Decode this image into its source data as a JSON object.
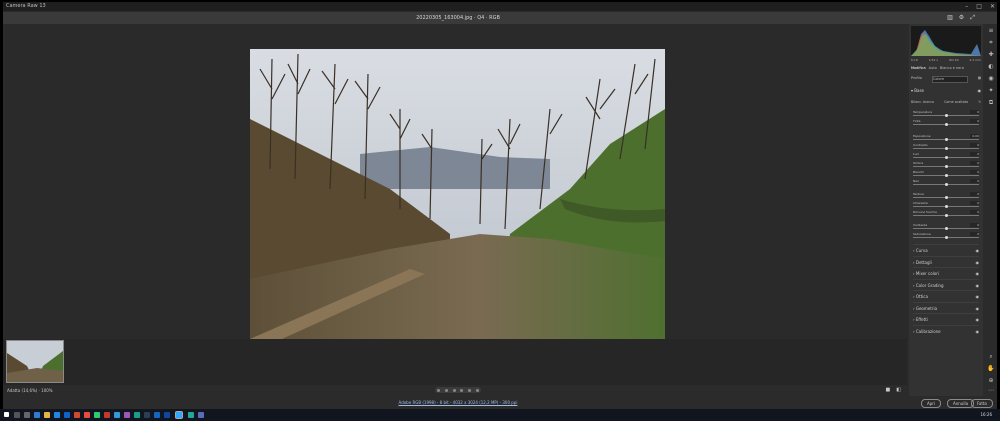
{
  "app": {
    "title": "Camera Raw 13"
  },
  "file": {
    "name": "20220305_163004.jpg · Q4 · RGB"
  },
  "bottom": {
    "zoom": "Adatta (14,6%)",
    "zoom_pct": "100%"
  },
  "workflow": {
    "link": "Adobe RGB (1998) - 8 bit - 4032 x 3024 (12,2 MP) - 300 ppi",
    "cancel": "Annulla",
    "done": "Fatto",
    "open": "Apri"
  },
  "panel": {
    "histo_info": [
      "f/1,8",
      "1/34 s",
      "ISO 64",
      "4,3 mm"
    ],
    "tabs": [
      "Modifica",
      "Auto",
      "Bianco e nero"
    ],
    "profile_label": "Profilo",
    "profile_value": "Colore",
    "basic_title": "Base",
    "wb_label": "Bilanc. bianco",
    "wb_value": "Come scattata",
    "sliders": [
      {
        "label": "Temperatura",
        "value": "0",
        "pos": 0.5
      },
      {
        "label": "Tinta",
        "value": "0",
        "pos": 0.5
      },
      {
        "label": "Esposizione",
        "value": "0,00",
        "pos": 0.5
      },
      {
        "label": "Contrasto",
        "value": "0",
        "pos": 0.5
      },
      {
        "label": "Luci",
        "value": "0",
        "pos": 0.5
      },
      {
        "label": "Ombre",
        "value": "0",
        "pos": 0.5
      },
      {
        "label": "Bianchi",
        "value": "0",
        "pos": 0.5
      },
      {
        "label": "Neri",
        "value": "0",
        "pos": 0.5
      },
      {
        "label": "Texture",
        "value": "0",
        "pos": 0.5
      },
      {
        "label": "Chiarezza",
        "value": "0",
        "pos": 0.5
      },
      {
        "label": "Rimuovi foschia",
        "value": "0",
        "pos": 0.5
      },
      {
        "label": "Vividezza",
        "value": "0",
        "pos": 0.5
      },
      {
        "label": "Saturazione",
        "value": "0",
        "pos": 0.5
      }
    ],
    "sections": [
      "Curva",
      "Dettagli",
      "Mixer colori",
      "Color Grading",
      "Ottica",
      "Geometria",
      "Effetti",
      "Calibrazione"
    ]
  },
  "tray": {
    "time": "16:26"
  },
  "colors": {
    "panel_bg": "#323232",
    "canvas_bg": "#2a2a2a",
    "accent": "#9fbce6"
  }
}
